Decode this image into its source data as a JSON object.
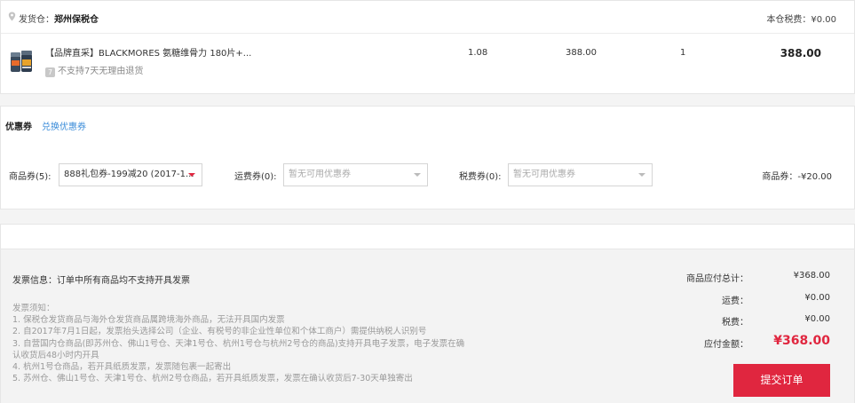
{
  "warehouse": {
    "label": "发货仓：",
    "name": "郑州保税仓",
    "tax_label": "本仓税费：¥0.00"
  },
  "product": {
    "name": "【品牌直采】BLACKMORES 氨糖维骨力 180片+...",
    "return_tag": "7",
    "return_note": "不支持7天无理由退货",
    "tax": "1.08",
    "price": "388.00",
    "qty": "1",
    "subtotal": "388.00"
  },
  "coupon": {
    "title": "优惠券",
    "exchange_link": "兑换优惠券",
    "goods_label": "商品券(5):",
    "goods_selected": "888礼包券-199减20 (2017-1...",
    "shipping_label": "运费券(0):",
    "shipping_placeholder": "暂无可用优惠券",
    "tax_label": "税费券(0):",
    "tax_placeholder": "暂无可用优惠券",
    "discount": "商品券：-¥20.00"
  },
  "invoice": {
    "info": "发票信息：订单中所有商品均不支持开具发票",
    "notes": [
      "发票须知：",
      "1. 保税仓发货商品与海外仓发货商品属跨境海外商品，无法开具国内发票",
      "2. 自2017年7月1日起，发票抬头选择公司（企业、有税号的非企业性单位和个体工商户）需提供纳税人识别号",
      "3. 自营国内仓商品(即苏州仓、佛山1号仓、天津1号仓、杭州1号仓与杭州2号仓的商品)支持开具电子发票，电子发票在确",
      "认收货后48小时内开具",
      "4. 杭州1号仓商品，若开具纸质发票，发票随包裹一起寄出",
      "5. 苏州仓、佛山1号仓、天津1号仓、杭州2号仓商品，若开具纸质发票，发票在确认收货后7-30天单独寄出"
    ]
  },
  "summary": {
    "goods_total_label": "商品应付总计：",
    "goods_total": "¥368.00",
    "shipping_label": "运费：",
    "shipping": "¥0.00",
    "tax_label": "税费：",
    "tax": "¥0.00",
    "payable_label": "应付金额：",
    "payable": "¥368.00",
    "submit_label": "提交订单"
  },
  "colors": {
    "accent": "#e0263f",
    "link": "#3b8cd9"
  }
}
